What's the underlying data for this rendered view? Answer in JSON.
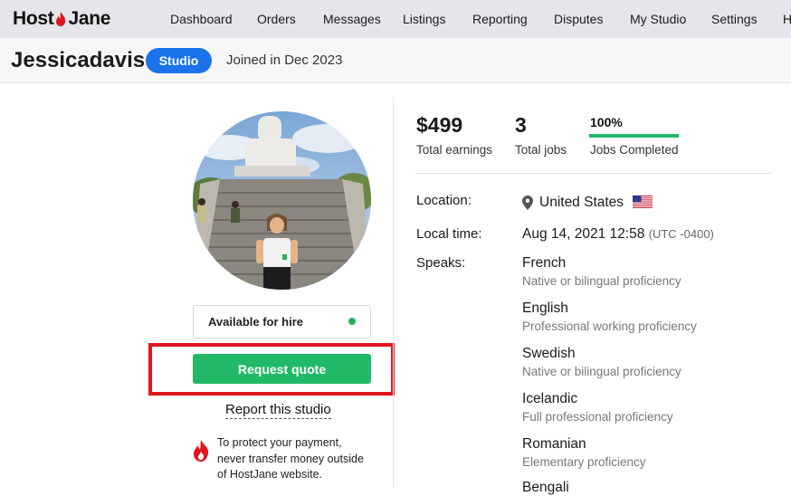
{
  "nav": {
    "logo_left": "Host",
    "logo_right": "Jane",
    "items": [
      "Dashboard",
      "Orders",
      "Messages",
      "Listings",
      "Reporting",
      "Disputes",
      "My Studio",
      "Settings",
      "H"
    ]
  },
  "header": {
    "username": "Jessicadavis",
    "badge": "Studio",
    "joined": "Joined in Dec 2023"
  },
  "sidebar": {
    "availability": "Available for hire",
    "availability_color": "#22b35e",
    "request_quote": "Request quote",
    "report": "Report this studio",
    "protect_lines": [
      "To protect your payment,",
      "never transfer money outside",
      "of HostJane website."
    ]
  },
  "stats": {
    "earnings_value": "$499",
    "earnings_label": "Total earnings",
    "jobs_value": "3",
    "jobs_label": "Total jobs",
    "completed_value": "100%",
    "completed_label": "Jobs Completed",
    "completed_fraction": 1.0
  },
  "info": {
    "location_label": "Location:",
    "location_value": "United States",
    "time_label": "Local time:",
    "time_value": "Aug 14, 2021 12:58",
    "time_zone": "(UTC -0400)",
    "speaks_label": "Speaks:"
  },
  "languages": [
    {
      "name": "French",
      "level": "Native or bilingual proficiency"
    },
    {
      "name": "English",
      "level": "Professional working proficiency"
    },
    {
      "name": "Swedish",
      "level": "Native or bilingual proficiency"
    },
    {
      "name": "Icelandic",
      "level": "Full professional proficiency"
    },
    {
      "name": "Romanian",
      "level": "Elementary proficiency"
    },
    {
      "name": "Bengali",
      "level": ""
    }
  ],
  "colors": {
    "brand_red": "#e0161e",
    "studio_blue": "#1a73e8",
    "action_green": "#21b968"
  }
}
